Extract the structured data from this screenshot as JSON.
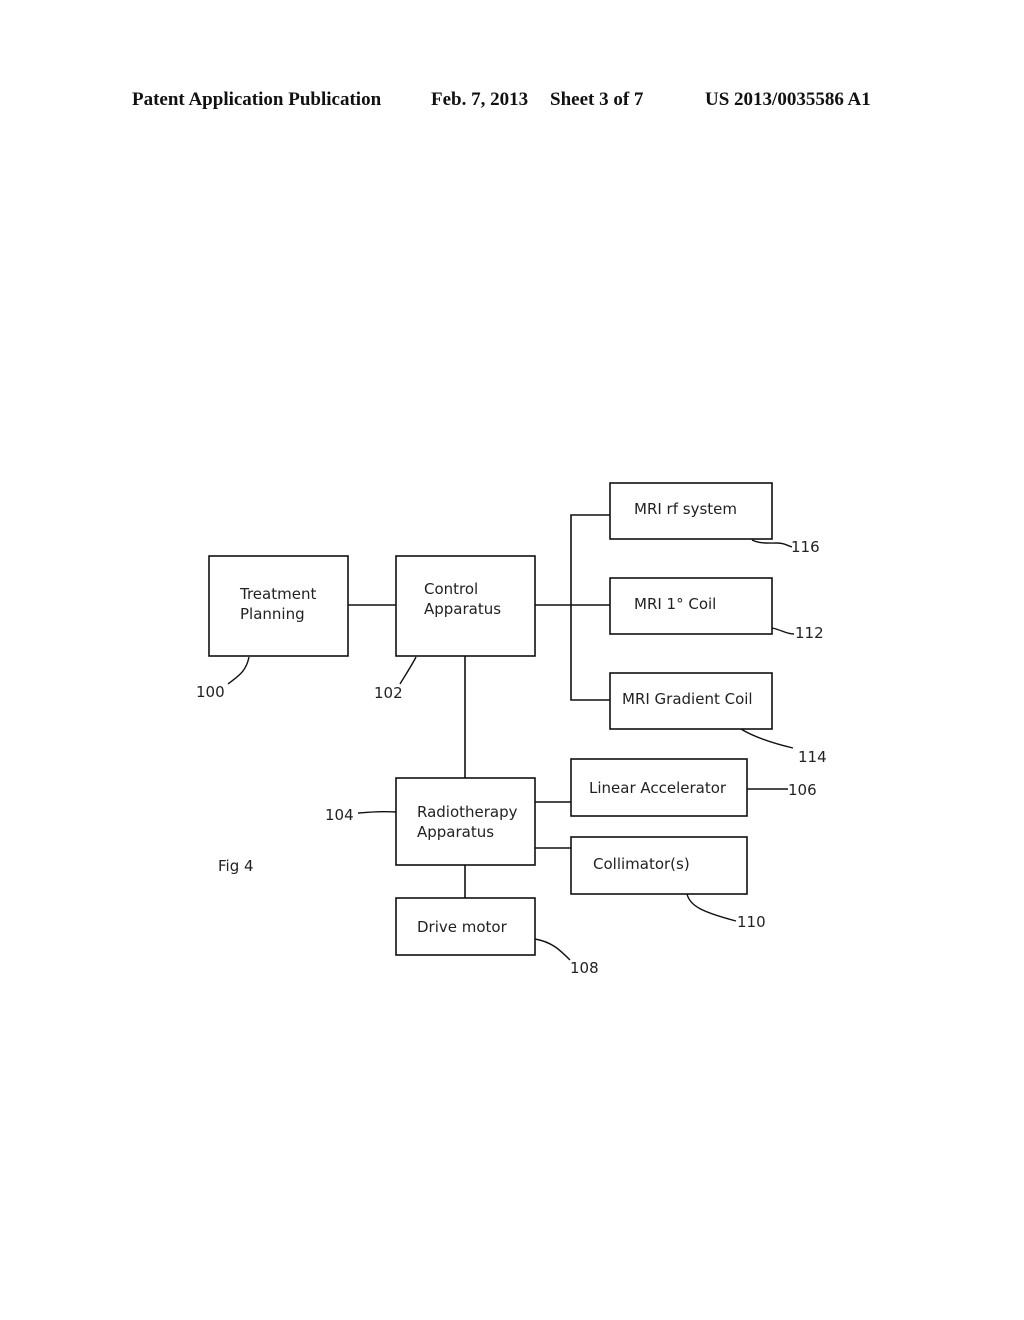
{
  "header": {
    "publication": "Patent Application Publication",
    "date": "Feb. 7, 2013",
    "sheet": "Sheet 3 of 7",
    "number": "US 2013/0035586 A1"
  },
  "figure": {
    "caption": "Fig 4",
    "blocks": {
      "treatment_planning": {
        "line1": "Treatment",
        "line2": "Planning",
        "ref": "100"
      },
      "control_apparatus": {
        "line1": "Control",
        "line2": "Apparatus",
        "ref": "102"
      },
      "radiotherapy_apparatus": {
        "line1": "Radiotherapy",
        "line2": "Apparatus",
        "ref": "104"
      },
      "linear_accelerator": {
        "label": "Linear Accelerator",
        "ref": "106"
      },
      "drive_motor": {
        "label": "Drive motor",
        "ref": "108"
      },
      "collimators": {
        "label": "Collimator(s)",
        "ref": "110"
      },
      "mri_primary_coil": {
        "label": "MRI 1° Coil",
        "ref": "112"
      },
      "mri_gradient_coil": {
        "label": "MRI Gradient Coil",
        "ref": "114"
      },
      "mri_rf_system": {
        "label": "MRI rf system",
        "ref": "116"
      }
    },
    "connections": [
      [
        "treatment_planning",
        "control_apparatus"
      ],
      [
        "control_apparatus",
        "mri_rf_system"
      ],
      [
        "control_apparatus",
        "mri_primary_coil"
      ],
      [
        "control_apparatus",
        "mri_gradient_coil"
      ],
      [
        "control_apparatus",
        "radiotherapy_apparatus"
      ],
      [
        "radiotherapy_apparatus",
        "linear_accelerator"
      ],
      [
        "radiotherapy_apparatus",
        "collimators"
      ],
      [
        "radiotherapy_apparatus",
        "drive_motor"
      ]
    ]
  }
}
